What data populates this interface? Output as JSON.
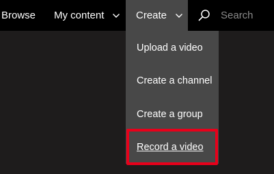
{
  "nav": {
    "browse": "Browse",
    "my_content": "My content",
    "create": "Create"
  },
  "search": {
    "placeholder": "Search"
  },
  "create_menu": {
    "items": [
      {
        "label": "Upload a video"
      },
      {
        "label": "Create a channel"
      },
      {
        "label": "Create a group"
      },
      {
        "label": "Record a video",
        "highlighted": true
      }
    ]
  },
  "colors": {
    "topbar_bg": "#000000",
    "active_bg": "#484848",
    "page_bg": "#1e1c1c",
    "highlight_border": "#e8001a"
  },
  "icons": {
    "search": "search-icon",
    "chevron": "chevron-down-icon"
  }
}
